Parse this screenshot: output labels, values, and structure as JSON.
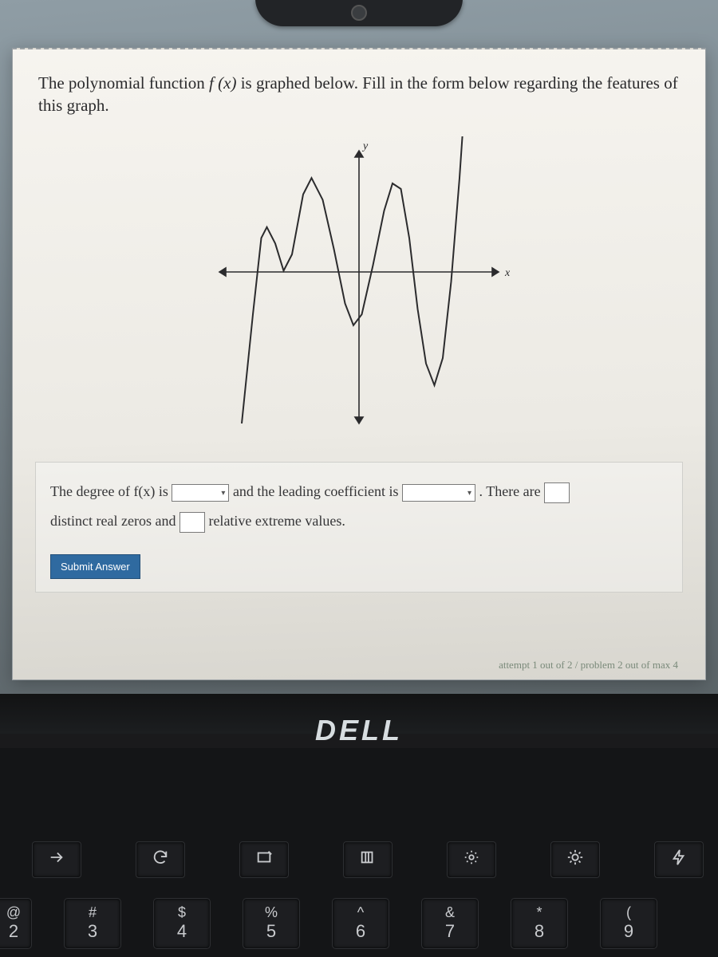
{
  "question": {
    "prompt_pre": "The polynomial function ",
    "prompt_fx": "f (x)",
    "prompt_post": " is graphed below. Fill in the form below regarding the features of this graph."
  },
  "answer": {
    "line1_a": "The degree of f(x) is ",
    "line1_b": " and the leading coefficient is ",
    "line1_c": ". There are ",
    "line2_a": "distinct real zeros and ",
    "line2_b": " relative extreme values."
  },
  "submit_label": "Submit Answer",
  "attempt_text": "attempt 1 out of 2 / problem 2 out of max 4",
  "axis": {
    "x": "x",
    "y": "y"
  },
  "laptop_brand": "DELL",
  "fn_icons": [
    "arrow-right",
    "refresh",
    "rect",
    "pause",
    "sun-low",
    "sun-high",
    "bolt"
  ],
  "num_keys": [
    {
      "sym": "@",
      "dig": "2"
    },
    {
      "sym": "#",
      "dig": "3"
    },
    {
      "sym": "$",
      "dig": "4"
    },
    {
      "sym": "%",
      "dig": "5"
    },
    {
      "sym": "^",
      "dig": "6"
    },
    {
      "sym": "&",
      "dig": "7"
    },
    {
      "sym": "*",
      "dig": "8"
    },
    {
      "sym": "(",
      "dig": "9"
    }
  ],
  "chart_data": {
    "type": "line",
    "title": "",
    "xlabel": "x",
    "ylabel": "y",
    "xlim": [
      -5,
      5
    ],
    "ylim": [
      -6,
      4
    ],
    "series": [
      {
        "name": "f(x)",
        "points": [
          [
            -4.2,
            -6
          ],
          [
            -3.8,
            -2
          ],
          [
            -3.5,
            0.8
          ],
          [
            -3.3,
            1.2
          ],
          [
            -3.0,
            0.6
          ],
          [
            -2.7,
            -0.4
          ],
          [
            -2.4,
            0.2
          ],
          [
            -2.0,
            2.4
          ],
          [
            -1.7,
            3.0
          ],
          [
            -1.3,
            2.2
          ],
          [
            -0.9,
            0.4
          ],
          [
            -0.5,
            -1.6
          ],
          [
            -0.2,
            -2.4
          ],
          [
            0.1,
            -2.0
          ],
          [
            0.5,
            -0.2
          ],
          [
            0.9,
            1.8
          ],
          [
            1.2,
            2.8
          ],
          [
            1.5,
            2.6
          ],
          [
            1.8,
            0.8
          ],
          [
            2.1,
            -1.8
          ],
          [
            2.4,
            -3.8
          ],
          [
            2.7,
            -4.6
          ],
          [
            3.0,
            -3.6
          ],
          [
            3.3,
            -0.8
          ],
          [
            3.6,
            3.0
          ],
          [
            3.8,
            6.0
          ]
        ]
      }
    ]
  }
}
